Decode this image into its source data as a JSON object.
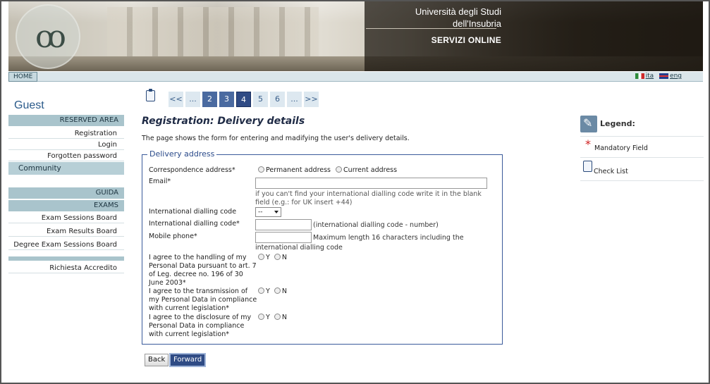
{
  "banner": {
    "uni_line1": "Università degli Studi",
    "uni_line2": "dell'Insubria",
    "servizi": "SERVIZI ONLINE"
  },
  "topnav": {
    "home": "HOME",
    "lang_it": "ita",
    "lang_en": "eng"
  },
  "sidebar": {
    "guest": "Guest",
    "reserved_area": "RESERVED AREA",
    "registration": "Registration",
    "login": "Login",
    "forgotten_password": "Forgotten password",
    "community": "Community",
    "guida": "GUIDA",
    "exams": "EXAMS",
    "exam_sessions_board": "Exam Sessions Board",
    "exam_results_board": "Exam Results Board",
    "degree_exam_sessions_board": "Degree Exam Sessions Board",
    "richiesta_accredito": "Richiesta Accredito"
  },
  "pager": {
    "first": "<<",
    "ellipsis_left": "...",
    "p2": "2",
    "p3": "3",
    "p4": "4",
    "p5": "5",
    "p6": "6",
    "ellipsis_right": "...",
    "last": ">>"
  },
  "page": {
    "title": "Registration: Delivery details",
    "description": "The page shows the form for entering and madifying the user's delivery details."
  },
  "form": {
    "legend": "Delivery address",
    "correspondence_label": "Correspondence address*",
    "permanent_address": "Permanent address",
    "current_address": "Current address",
    "email_label": "Email*",
    "email_value": "",
    "email_hint_1": "if you can't find your international dialling code write it in the blank",
    "email_hint_2": "field (e.g.: for UK insert +44)",
    "intl_code_label": "International dialling code",
    "intl_code_select": "--",
    "intl_code_star_label": "International dialling code*",
    "intl_code_hint": "(international dialling code - number)",
    "mobile_label": "Mobile phone*",
    "mobile_hint_1": "Maximum length 16 characters including the",
    "mobile_hint_2": "international dialling code",
    "agree1_lines": [
      "I agree to the handling of my",
      "Personal Data pursuant to art. 7",
      "of Leg. decree no. 196 of 30",
      "June 2003*"
    ],
    "agree2_lines": [
      "I agree to the transmission of",
      "my Personal Data in compliance",
      "with current legislation*"
    ],
    "agree3_lines": [
      "I agree to the disclosure of my",
      "Personal Data in compliance",
      "with current legislation*"
    ],
    "yes": "Y",
    "no": "N",
    "back": "Back",
    "forward": "Forward"
  },
  "legend_panel": {
    "title": "Legend:",
    "mandatory": "Mandatory Field",
    "checklist": "Check List"
  },
  "colors": {
    "accent": "#2f4b85",
    "sidebar_head": "#a9c4cc",
    "star": "#d02020"
  }
}
